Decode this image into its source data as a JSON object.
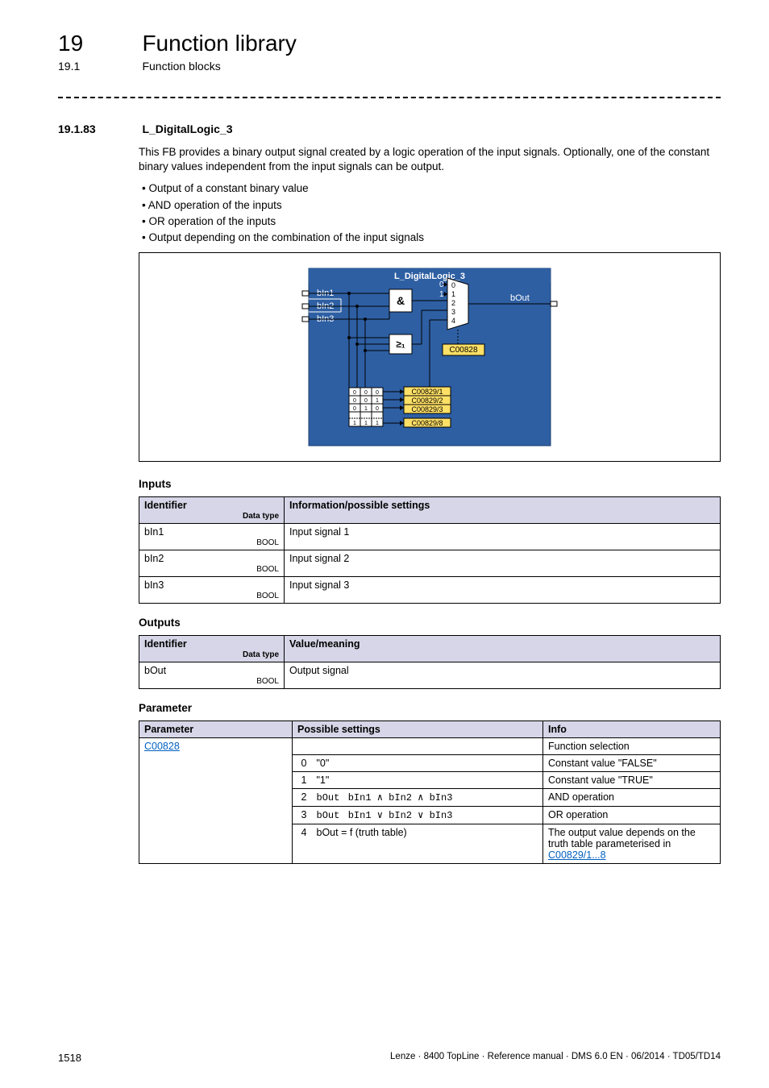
{
  "header": {
    "chapter_num": "19",
    "chapter_title": "Function library",
    "section_num": "19.1",
    "section_title": "Function blocks"
  },
  "subsection": {
    "num": "19.1.83",
    "title": "L_DigitalLogic_3"
  },
  "intro_para": "This FB provides a binary output signal created by a logic operation of the input signals. Optionally, one of the constant binary values independent from the input signals can be output.",
  "bullets": [
    "Output of a constant binary value",
    "AND operation of the inputs",
    "OR operation of the inputs",
    "Output depending on the combination of the input signals"
  ],
  "diagram": {
    "title": "L_DigitalLogic_3",
    "inputs": [
      "bIn1",
      "bIn2",
      "bIn3"
    ],
    "and_sym": "&",
    "or_sym": "≥₁",
    "mux_labels": [
      "0",
      "1",
      "2",
      "3",
      "4"
    ],
    "mux_top0": "0",
    "mux_top1": "1",
    "out_label": "bOut",
    "sel_code": "C00828",
    "truth_codes": [
      "C00829/1",
      "C00829/2",
      "C00829/3",
      "C00829/8"
    ],
    "truth_rows": [
      [
        "0",
        "0",
        "0"
      ],
      [
        "0",
        "0",
        "1"
      ],
      [
        "0",
        "1",
        "0"
      ],
      [
        "1",
        "1",
        "1"
      ]
    ]
  },
  "inputs_table": {
    "heading": "Inputs",
    "head_id": "Identifier",
    "head_dt": "Data type",
    "head_info": "Information/possible settings",
    "rows": [
      {
        "id": "bIn1",
        "dt": "BOOL",
        "info": "Input signal 1"
      },
      {
        "id": "bIn2",
        "dt": "BOOL",
        "info": "Input signal 2"
      },
      {
        "id": "bIn3",
        "dt": "BOOL",
        "info": "Input signal 3"
      }
    ]
  },
  "outputs_table": {
    "heading": "Outputs",
    "head_id": "Identifier",
    "head_dt": "Data type",
    "head_info": "Value/meaning",
    "rows": [
      {
        "id": "bOut",
        "dt": "BOOL",
        "info": "Output signal"
      }
    ]
  },
  "param_table": {
    "heading": "Parameter",
    "head_param": "Parameter",
    "head_set": "Possible settings",
    "head_info": "Info",
    "param_link": "C00828",
    "row0_info": "Function selection",
    "rows": [
      {
        "n": "0",
        "setting_plain": "\"0\"",
        "info": "Constant value \"FALSE\""
      },
      {
        "n": "1",
        "setting_plain": "\"1\"",
        "info": "Constant value \"TRUE\""
      },
      {
        "n": "2",
        "setting_expr_lhs": "bOut",
        "setting_expr_rhs": "bIn1 ∧ bIn2 ∧ bIn3",
        "info": "AND operation"
      },
      {
        "n": "3",
        "setting_expr_lhs": "bOut",
        "setting_expr_rhs": "bIn1 ∨ bIn2 ∨ bIn3",
        "info": "OR operation"
      },
      {
        "n": "4",
        "setting_plain": "bOut = f (truth table)",
        "info_pre": "The output value depends on the truth table parameterised in ",
        "info_link": "C00829/1...8"
      }
    ]
  },
  "footer": {
    "page": "1518",
    "text": "Lenze · 8400 TopLine · Reference manual · DMS 6.0 EN · 06/2014 · TD05/TD14"
  }
}
